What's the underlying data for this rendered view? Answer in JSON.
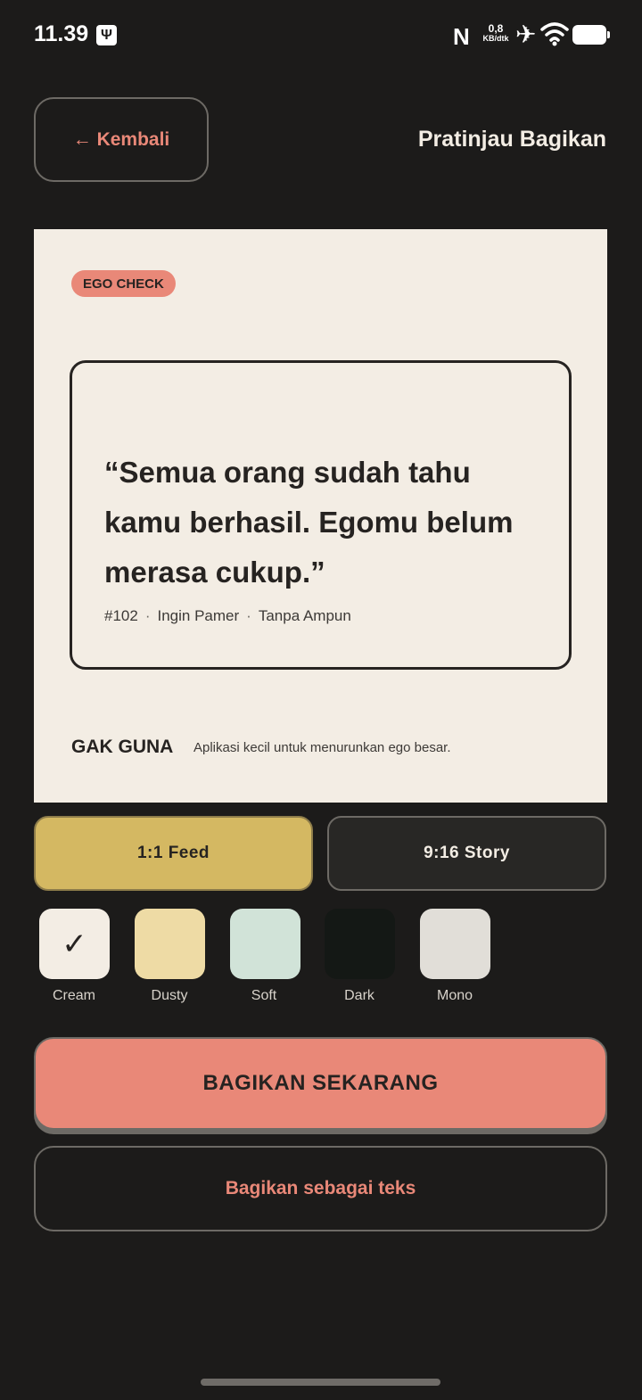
{
  "status_bar": {
    "time": "11.39",
    "speed_value": "0,8",
    "speed_unit": "KB/dtk"
  },
  "header": {
    "back_label": "← Kembali",
    "title": "Pratinjau Bagikan"
  },
  "preview": {
    "badge": "EGO CHECK",
    "quote": "“Semua orang sudah tahu kamu berhasil. Egomu belum merasa cukup.”",
    "meta": [
      "#102",
      "Ingin Pamer",
      "Tanpa Ampun"
    ],
    "meta_separator": "·",
    "brand": "GAK GUNA",
    "tagline": "Aplikasi kecil untuk menurunkan ego besar."
  },
  "formats": [
    {
      "label": "1:1 Feed",
      "selected": true
    },
    {
      "label": "9:16 Story",
      "selected": false
    }
  ],
  "themes": [
    {
      "label": "Cream",
      "color": "#f3ede4",
      "selected": true,
      "check": "✓"
    },
    {
      "label": "Dusty",
      "color": "#eedba5",
      "selected": false
    },
    {
      "label": "Soft",
      "color": "#d1e3d8",
      "selected": false
    },
    {
      "label": "Dark",
      "color": "#141815",
      "selected": false
    },
    {
      "label": "Mono",
      "color": "#e1ded8",
      "selected": false
    }
  ],
  "actions": {
    "share_now": "BAGIKAN SEKARANG",
    "share_as_text": "Bagikan sebagai teks"
  },
  "colors": {
    "background": "#1c1b1a",
    "accent": "#e98878",
    "gold": "#d4b862",
    "card": "#f3ede4"
  }
}
